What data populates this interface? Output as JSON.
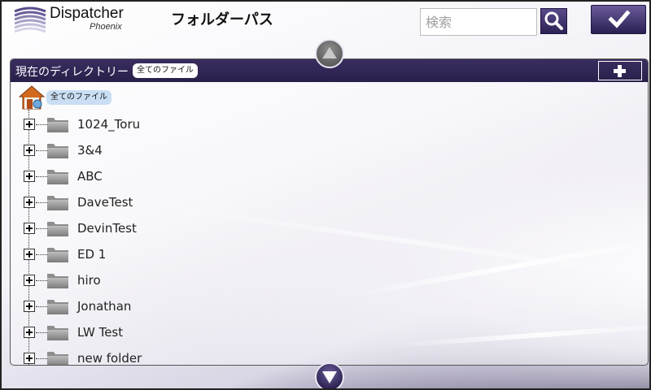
{
  "app": {
    "name": "Dispatcher",
    "subname": "Phoenix",
    "page_title": "フォルダーパス"
  },
  "search": {
    "placeholder": "検索",
    "value": ""
  },
  "panel": {
    "current_dir_label": "現在のディレクトリー ::",
    "current_dir_chip": "全てのファイル",
    "home_chip": "全てのファイル"
  },
  "folders": [
    {
      "name": "1024_Toru"
    },
    {
      "name": "3&4"
    },
    {
      "name": "ABC"
    },
    {
      "name": "DaveTest"
    },
    {
      "name": "DevinTest"
    },
    {
      "name": "ED 1"
    },
    {
      "name": "hiro"
    },
    {
      "name": "Jonathan"
    },
    {
      "name": "LW Test"
    },
    {
      "name": "new folder"
    }
  ],
  "icons": {
    "logo": "dispatcher-logo-icon",
    "search": "search-icon",
    "confirm": "checkmark-icon",
    "add": "plus-icon",
    "home": "home-icon",
    "folder": "folder-icon",
    "expand": "expand-plus-icon",
    "scroll_up": "arrow-up-icon",
    "scroll_down": "arrow-down-icon"
  },
  "colors": {
    "accent": "#2e2255",
    "panel_header": "#2f2452",
    "chip_home": "#c9def3"
  }
}
